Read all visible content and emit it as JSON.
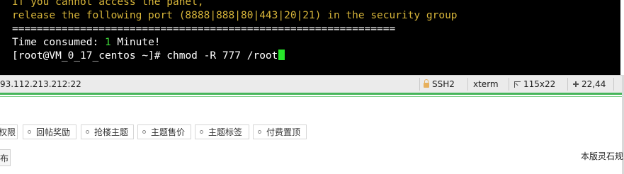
{
  "terminal": {
    "lines": [
      {
        "text": "If you cannot access the panel,"
      },
      {
        "text": "release the following port (8888|888|80|443|20|21) in the security group"
      },
      {
        "text": "=============================================================="
      },
      {
        "label": "Time consumed: ",
        "value": "1",
        "suffix": " Minute!"
      },
      {
        "prompt": "[root@VM_0_17_centos ~]# ",
        "command": "chmod -R 777 /root"
      }
    ]
  },
  "statusbar": {
    "host": "93.112.213.212:22",
    "protocol": "SSH2",
    "terminal_type": "xterm",
    "size": "115x22",
    "cursor_pos": "22,44"
  },
  "tags": [
    "权限",
    "回帖奖励",
    "抢楼主题",
    "主题售价",
    "主题标签",
    "付费置顶"
  ],
  "small_button": "发布",
  "footer_right": "本版灵石规",
  "colors": {
    "terminal_yellow": "#d7b53a",
    "cursor_green": "#27e62a",
    "divider_green": "#46b55a"
  }
}
